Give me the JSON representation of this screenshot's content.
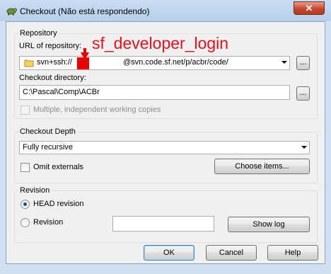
{
  "window": {
    "title": "Checkout (Não está respondendo)",
    "close_label": "✕"
  },
  "repository": {
    "group_label": "Repository",
    "url_label": "URL of repository:",
    "url_value_prefix": "svn+ssh://",
    "url_value_suffix": "@svn.code.sf.net/p/acbr/code/",
    "browse_label": "...",
    "dir_label": "Checkout directory:",
    "dir_value": "C:\\Pascal\\Comp\\ACBr",
    "dir_browse_label": "...",
    "multiple_label": "Multiple, independent working copies"
  },
  "depth": {
    "group_label": "Checkout Depth",
    "selected": "Fully recursive",
    "omit_label": "Omit externals",
    "choose_label": "Choose items..."
  },
  "revision": {
    "group_label": "Revision",
    "head_label": "HEAD revision",
    "revision_label": "Revision",
    "show_log_label": "Show log",
    "revision_value": ""
  },
  "buttons": {
    "ok": "OK",
    "cancel": "Cancel",
    "help": "Help"
  },
  "annotation": {
    "text": "sf_developer_login",
    "color": "#e8101c"
  }
}
